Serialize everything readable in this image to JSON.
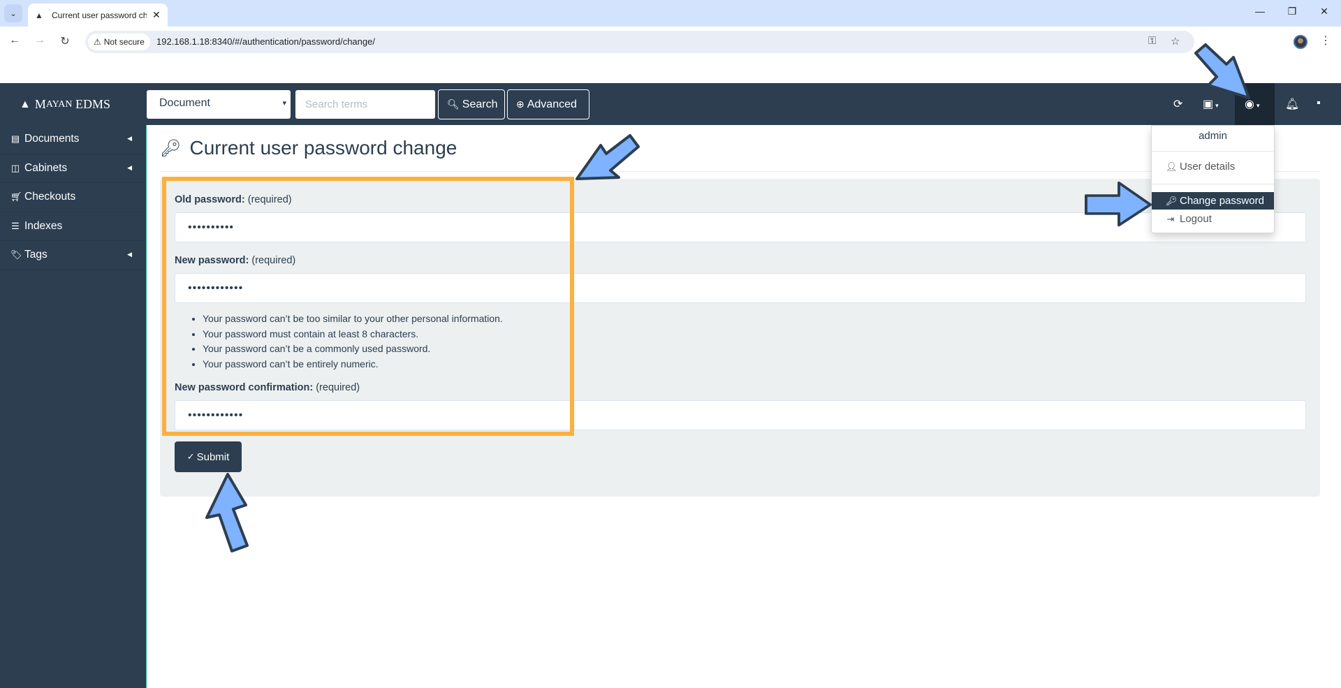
{
  "browser": {
    "tab_title": "Current user password change",
    "tab_title_visible": "Current user password ch",
    "security_label": "Not secure",
    "url": "192.168.1.18:8340/#/authentication/password/change/",
    "icons": {
      "tab_menu": "chevron-down-icon",
      "back": "back-arrow-icon",
      "forward": "forward-arrow-icon",
      "reload": "reload-icon",
      "password_key": "key-icon",
      "bookmark": "star-icon",
      "profile": "avatar",
      "menu": "kebab-icon",
      "minimize": "minimize-icon",
      "restore": "restore-icon",
      "close": "close-icon"
    }
  },
  "navbar": {
    "brand_prefix": "M",
    "brand_small": "ayan",
    "brand_suffix": " EDMS",
    "search_model": "Document",
    "search_placeholder": "Search terms",
    "search_value": "",
    "search_button": "Search",
    "advanced_button": "Advanced"
  },
  "user_menu": {
    "header": "admin",
    "items": [
      {
        "label": "User details",
        "icon": "user-icon",
        "active": false
      },
      {
        "label": "Change password",
        "icon": "key-icon",
        "active": true
      },
      {
        "label": "Logout",
        "icon": "sign-out-icon",
        "active": false
      }
    ]
  },
  "sidebar": {
    "items": [
      {
        "label": "Documents",
        "icon": "book-icon",
        "has_submenu": true
      },
      {
        "label": "Cabinets",
        "icon": "columns-icon",
        "has_submenu": true
      },
      {
        "label": "Checkouts",
        "icon": "cart-icon",
        "has_submenu": false
      },
      {
        "label": "Indexes",
        "icon": "list-icon",
        "has_submenu": false
      },
      {
        "label": "Tags",
        "icon": "tags-icon",
        "has_submenu": true
      }
    ]
  },
  "page": {
    "title": "Current user password change",
    "form": {
      "old_password": {
        "label": "Old password:",
        "hint": " (required)",
        "value": "••••••••••"
      },
      "new_password": {
        "label": "New password:",
        "hint": " (required)",
        "value": "••••••••••••"
      },
      "help": [
        "Your password can’t be too similar to your other personal information.",
        "Your password must contain at least 8 characters.",
        "Your password can’t be a commonly used password.",
        "Your password can’t be entirely numeric."
      ],
      "confirm_password": {
        "label": "New password confirmation:",
        "hint": " (required)",
        "value": "••••••••••••"
      },
      "submit_label": "Submit"
    }
  },
  "annotations": {
    "highlight_color": "#fbb040",
    "arrow_color": "#7fb2ff",
    "arrow_outline": "#2c3e50"
  }
}
